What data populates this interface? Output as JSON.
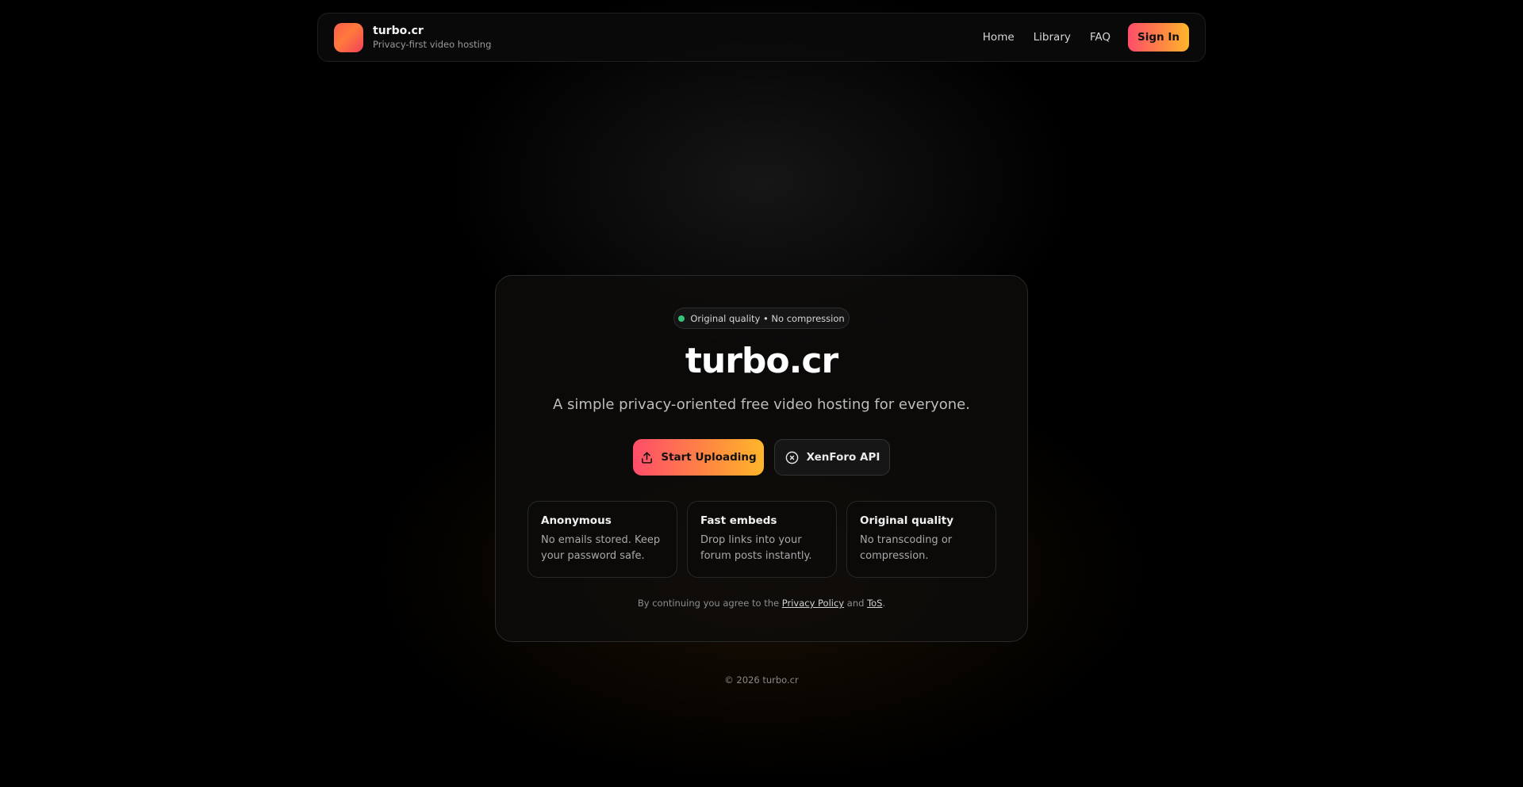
{
  "header": {
    "brand_name": "turbo.cr",
    "brand_tagline": "Privacy-first video hosting",
    "nav": [
      "Home",
      "Library",
      "FAQ"
    ],
    "signin_label": "Sign In"
  },
  "hero": {
    "badge": "Original quality • No compression",
    "title": "turbo.cr",
    "subtitle": "A simple privacy-oriented free video hosting for everyone.",
    "primary_button": "Start Uploading",
    "secondary_button": "XenForo API"
  },
  "features": [
    {
      "title": "Anonymous",
      "text": "No emails stored. Keep your password safe."
    },
    {
      "title": "Fast embeds",
      "text": "Drop links into your forum posts instantly."
    },
    {
      "title": "Original quality",
      "text": "No transcoding or compression."
    }
  ],
  "legal": {
    "prefix": "By continuing you agree to the",
    "privacy_link": "Privacy Policy",
    "conjunction": "and",
    "tos_link": "ToS",
    "suffix": "."
  },
  "footer": {
    "copyright": "© 2026 turbo.cr"
  },
  "colors": {
    "accent_start": "#ff4d6a",
    "accent_end": "#ffb62a",
    "status_dot": "#35c27a",
    "background": "#000000"
  },
  "icons": {
    "primary_button": "upload-icon",
    "secondary_button": "close-circle-icon"
  }
}
